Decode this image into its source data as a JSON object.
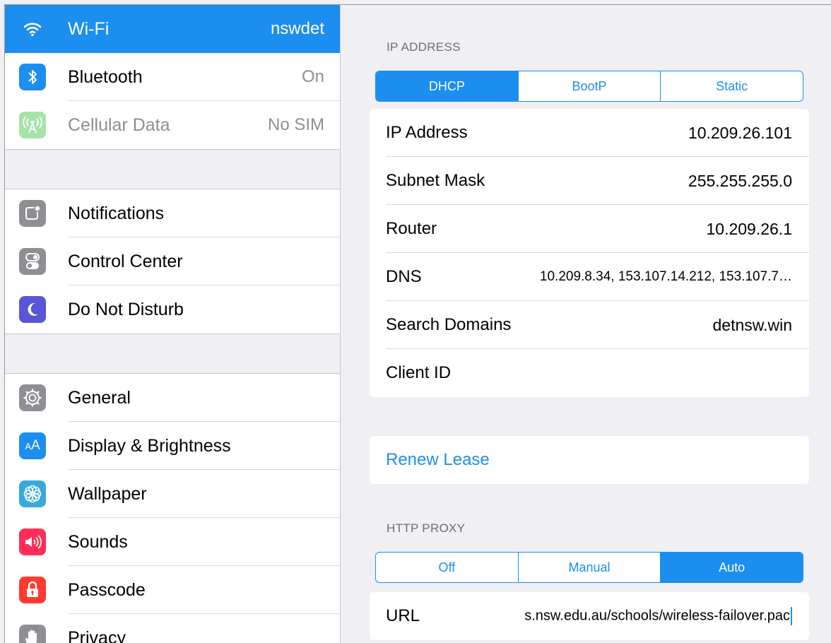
{
  "sidebar": {
    "group1": [
      {
        "label": "Wi-Fi",
        "value": "nswdet",
        "icon": "wifi-icon",
        "color": "#1c8ef0",
        "selected": true
      },
      {
        "label": "Bluetooth",
        "value": "On",
        "icon": "bluetooth-icon",
        "color": "#1c8ef0"
      },
      {
        "label": "Cellular Data",
        "value": "No SIM",
        "icon": "cellular-icon",
        "color": "#a6e3a9",
        "disabled": true
      }
    ],
    "group2": [
      {
        "label": "Notifications",
        "icon": "notifications-icon",
        "color": "#8e8e93"
      },
      {
        "label": "Control Center",
        "icon": "control-center-icon",
        "color": "#8e8e93"
      },
      {
        "label": "Do Not Disturb",
        "icon": "moon-icon",
        "color": "#5856d6"
      }
    ],
    "group3": [
      {
        "label": "General",
        "icon": "gear-icon",
        "color": "#8e8e93"
      },
      {
        "label": "Display & Brightness",
        "icon": "display-icon",
        "color": "#1c8ef0"
      },
      {
        "label": "Wallpaper",
        "icon": "wallpaper-icon",
        "color": "#35aadc"
      },
      {
        "label": "Sounds",
        "icon": "speaker-icon",
        "color": "#ff2d55"
      },
      {
        "label": "Passcode",
        "icon": "lock-icon",
        "color": "#ff3b30"
      },
      {
        "label": "Privacy",
        "icon": "hand-icon",
        "color": "#8e8e93"
      }
    ]
  },
  "detail": {
    "ip_header": "IP ADDRESS",
    "ip_modes": [
      "DHCP",
      "BootP",
      "Static"
    ],
    "ip_mode_selected": "DHCP",
    "rows": [
      {
        "label": "IP Address",
        "value": "10.209.26.101"
      },
      {
        "label": "Subnet Mask",
        "value": "255.255.255.0"
      },
      {
        "label": "Router",
        "value": "10.209.26.1"
      },
      {
        "label": "DNS",
        "value": "10.209.8.34, 153.107.14.212, 153.107.7…"
      },
      {
        "label": "Search Domains",
        "value": "detnsw.win"
      },
      {
        "label": "Client ID",
        "value": ""
      }
    ],
    "renew_label": "Renew Lease",
    "proxy_header": "HTTP PROXY",
    "proxy_modes": [
      "Off",
      "Manual",
      "Auto"
    ],
    "proxy_mode_selected": "Auto",
    "url_label": "URL",
    "url_value": "s.nsw.edu.au/schools/wireless-failover.pac"
  }
}
